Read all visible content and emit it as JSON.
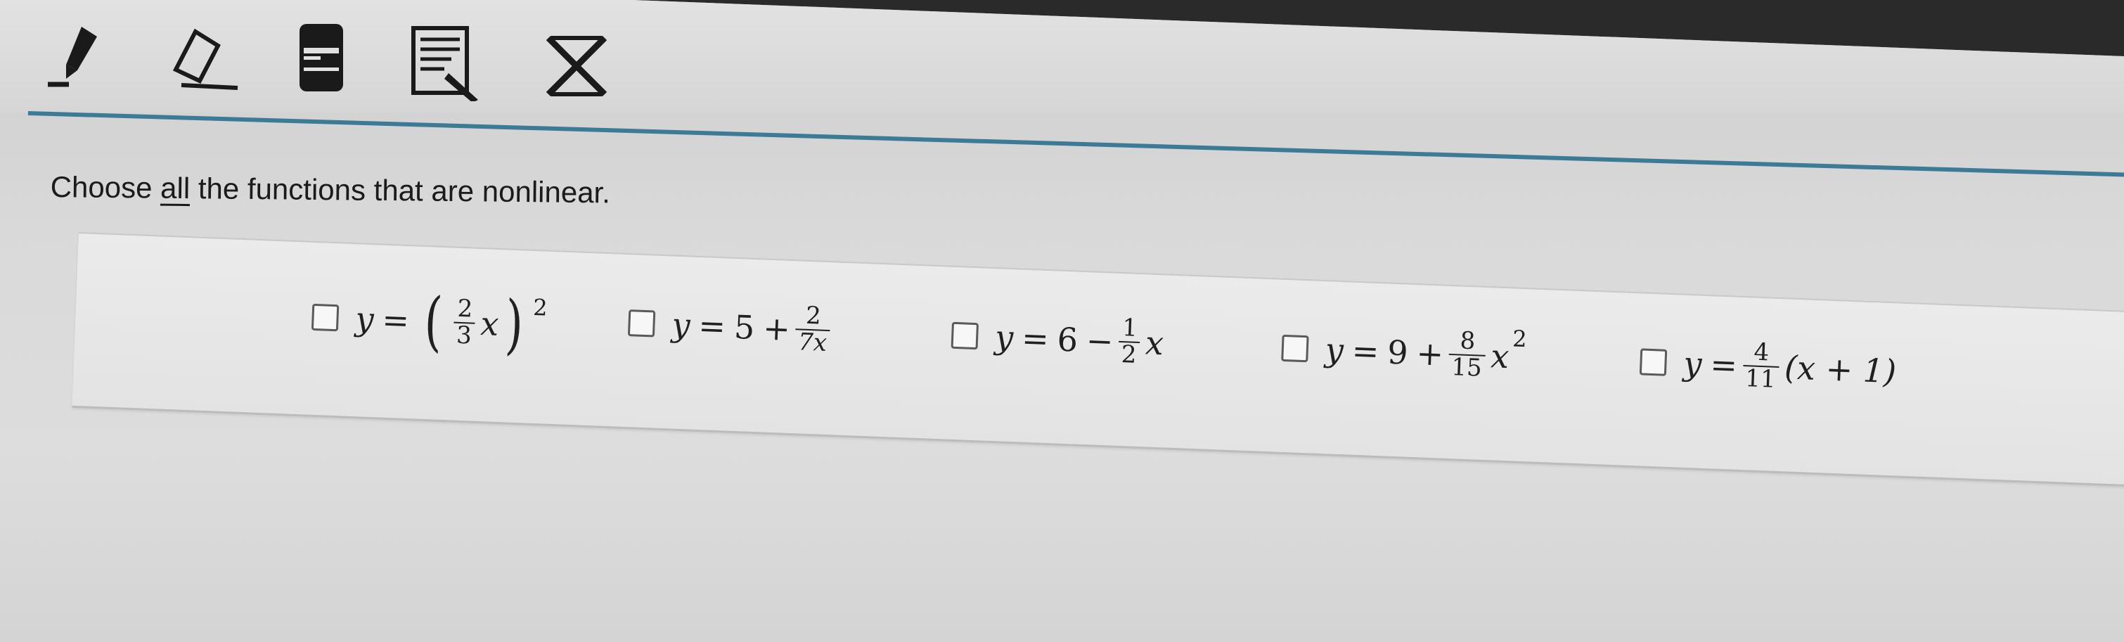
{
  "toolbar": {
    "tools": [
      {
        "icon": "pencil-icon"
      },
      {
        "icon": "eraser-icon"
      },
      {
        "icon": "highlighter-icon"
      },
      {
        "icon": "notepad-icon"
      },
      {
        "icon": "close-icon"
      }
    ]
  },
  "question": {
    "prefix": "Choose ",
    "emphasis": "all",
    "suffix": " the functions that are nonlinear."
  },
  "options": [
    {
      "id": "opt-1",
      "lhs": "y",
      "eq": "=",
      "frac_num": "2",
      "frac_den": "3",
      "var": "x",
      "exponent": "2"
    },
    {
      "id": "opt-2",
      "lhs": "y",
      "eq": "=",
      "const": "5",
      "op": "+",
      "frac_num": "2",
      "frac_den": "7x"
    },
    {
      "id": "opt-3",
      "lhs": "y",
      "eq": "=",
      "const": "6",
      "op": "−",
      "frac_num": "1",
      "frac_den": "2",
      "var": "x"
    },
    {
      "id": "opt-4",
      "lhs": "y",
      "eq": "=",
      "const": "9",
      "op": "+",
      "frac_num": "8",
      "frac_den": "15",
      "var": "x",
      "exponent": "2"
    },
    {
      "id": "opt-5",
      "lhs": "y",
      "eq": "=",
      "frac_num": "4",
      "frac_den": "11",
      "tail": "(x + 1)"
    }
  ]
}
